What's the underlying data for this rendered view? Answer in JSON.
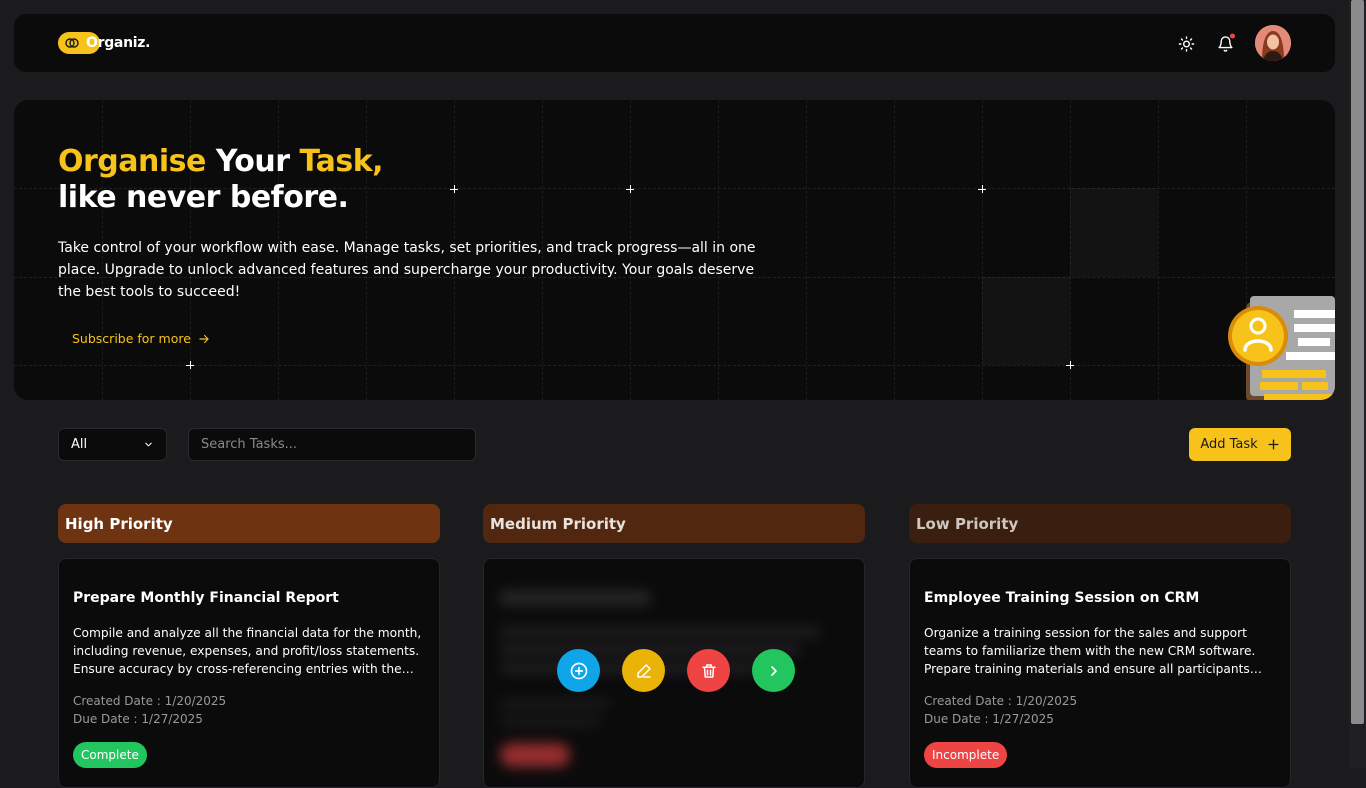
{
  "brand": {
    "name": "Organiz."
  },
  "hero": {
    "title_part1": "Organise",
    "title_part2": " Your ",
    "title_part3": "Task,",
    "title_line2": "like never before.",
    "description": "Take control of your workflow with ease. Manage tasks, set priorities, and track progress—all in one place. Upgrade to unlock advanced features and supercharge your productivity. Your goals deserve the best tools to succeed!",
    "subscribe_label": "Subscribe for more"
  },
  "toolbar": {
    "filter_value": "All",
    "search_placeholder": "Search Tasks...",
    "add_task_label": "Add Task"
  },
  "columns": [
    {
      "header": "High Priority",
      "color": "#6e3412",
      "card": {
        "title": "Prepare Monthly Financial Report",
        "description": "Compile and analyze all the financial data for the month, including revenue, expenses, and profit/loss statements. Ensure accuracy by cross-referencing entries with the financial records.",
        "created": "Created Date : 1/20/2025",
        "due": "Due Date : 1/27/2025",
        "status": "Complete",
        "status_color": "#22c55e"
      }
    },
    {
      "header": "Medium Priority",
      "color": "#52270f",
      "card": {
        "status_color": "#ef4444",
        "actions": [
          "add-icon",
          "edit-icon",
          "delete-icon",
          "next-icon"
        ],
        "action_colors": [
          "#0ea5e9",
          "#eab308",
          "#ef4444",
          "#22c55e"
        ]
      }
    },
    {
      "header": "Low Priority",
      "color": "#3a1f10",
      "card": {
        "title": "Employee Training Session on CRM",
        "description": "Organize a training session for the sales and support teams to familiarize them with the new CRM software. Prepare training materials and ensure all participants have their login credentials.",
        "created": "Created Date : 1/20/2025",
        "due": "Due Date : 1/27/2025",
        "status": "Incomplete",
        "status_color": "#ef4444"
      }
    }
  ],
  "colors": {
    "accent": "#f7c31b",
    "background": "#1b1a1c",
    "surface": "#0c0b0c"
  }
}
